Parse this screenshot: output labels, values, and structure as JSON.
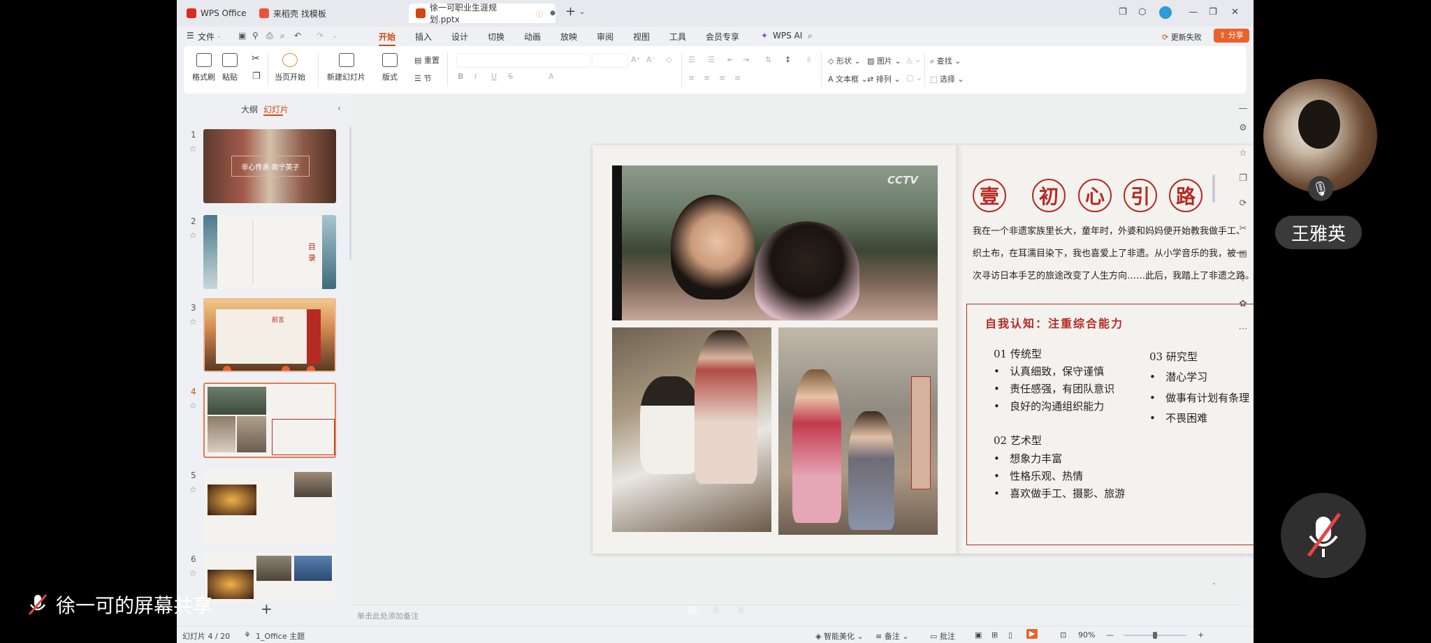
{
  "tabs": [
    {
      "label": "WPS Office",
      "icon": "wps-logo-icon",
      "active": false
    },
    {
      "label": "来稻壳 找模板",
      "icon": "docer-icon",
      "active": false
    },
    {
      "label": "徐一可职业生涯规划.pptx",
      "icon": "ppt-file-icon",
      "active": true
    }
  ],
  "menu": {
    "file": "文件",
    "items": [
      "开始",
      "插入",
      "设计",
      "切换",
      "动画",
      "放映",
      "审阅",
      "视图",
      "工具",
      "会员专享"
    ],
    "active": "开始",
    "wps_ai": "WPS AI",
    "update_fail": "更新失败",
    "share": "分享"
  },
  "ribbon": {
    "format_painter": "格式刷",
    "paste": "粘贴",
    "from_current": "当页开始",
    "new_slide": "新建幻灯片",
    "layout": "版式",
    "reset": "重置",
    "section": "节",
    "shape": "形状",
    "picture": "图片",
    "textbox": "文本框",
    "arrange": "排列",
    "find": "查找",
    "select": "选择"
  },
  "left_panel": {
    "tabs": [
      "大纲",
      "幻灯片"
    ],
    "active_tab": "幻灯片",
    "thumbnails": [
      {
        "num": "1",
        "text": "非心传承·南宁英子"
      },
      {
        "num": "2",
        "text": "目录"
      },
      {
        "num": "3",
        "text": "前言"
      },
      {
        "num": "4",
        "text": ""
      },
      {
        "num": "5",
        "text": ""
      },
      {
        "num": "6",
        "text": ""
      }
    ],
    "current": "4"
  },
  "slide": {
    "title_chars": [
      "壹",
      "初",
      "心",
      "引",
      "路"
    ],
    "watermark": "CCTV",
    "paragraph": [
      "我在一个非遗家族里长大，童年时，外婆和妈妈便开始教我做手工、",
      "织土布，在耳濡目染下，我也喜爱上了非遗。从小学音乐的我，被一",
      "次寻访日本手艺的旅途改变了人生方向……此后，我踏上了非遗之路。"
    ],
    "subtitle": "自我认知：注重综合能力",
    "groups": [
      {
        "title": "01 传统型",
        "items": [
          "认真细致，保守谨慎",
          "责任感强，有团队意识",
          "良好的沟通组织能力"
        ]
      },
      {
        "title": "02 艺术型",
        "items": [
          "想象力丰富",
          "性格乐观、热情",
          "喜欢做手工、摄影、旅游"
        ]
      },
      {
        "title": "03 研究型",
        "items": [
          "潜心学习",
          "做事有计划有条理",
          "不畏困难"
        ]
      }
    ]
  },
  "notes_placeholder": "单击此处添加备注",
  "status": {
    "slide_count": "幻灯片 4 / 20",
    "theme": "1_Office 主题",
    "beautify": "智能美化",
    "notes": "备注",
    "comments": "批注",
    "zoom": "90%"
  },
  "meeting": {
    "participant_name": "王雅英",
    "screen_share_label": "徐一可的屏幕共享"
  },
  "colors": {
    "accent": "#d4470f",
    "slide_red": "#b52a22",
    "share_button": "#e8632b"
  }
}
